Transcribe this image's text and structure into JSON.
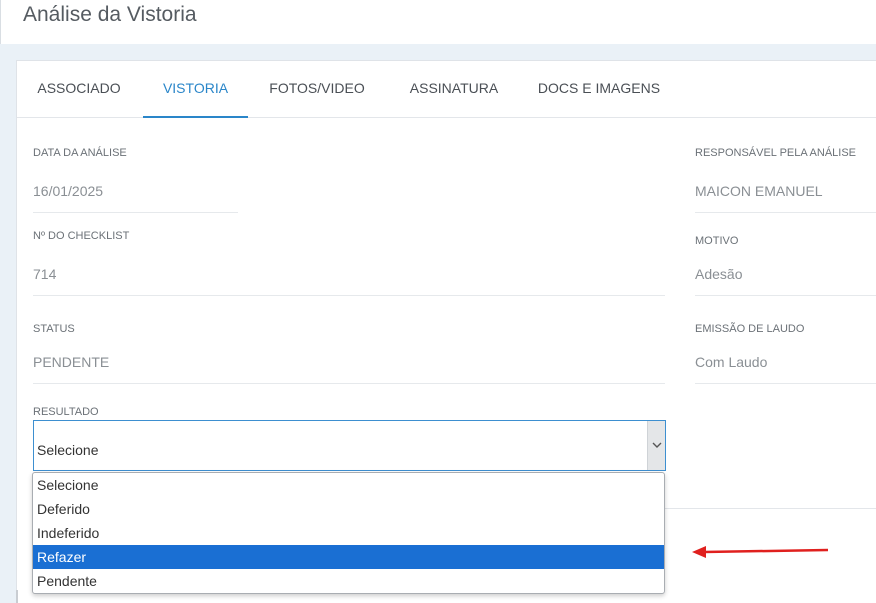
{
  "header": {
    "title": "Análise da Vistoria"
  },
  "tabs": [
    {
      "label": "ASSOCIADO"
    },
    {
      "label": "VISTORIA"
    },
    {
      "label": "FOTOS/VIDEO"
    },
    {
      "label": "ASSINATURA"
    },
    {
      "label": "DOCS E IMAGENS"
    }
  ],
  "active_tab": "VISTORIA",
  "fields": {
    "data_analise": {
      "label": "DATA DA ANÁLISE",
      "value": "16/01/2025"
    },
    "responsavel": {
      "label": "RESPONSÁVEL PELA ANÁLISE",
      "value": "MAICON EMANUEL"
    },
    "checklist": {
      "label": "Nº DO CHECKLIST",
      "value": "714"
    },
    "motivo": {
      "label": "MOTIVO",
      "value": "Adesão"
    },
    "status": {
      "label": "STATUS",
      "value": "PENDENTE"
    },
    "emissao": {
      "label": "EMISSÃO DE LAUDO",
      "value": "Com Laudo"
    }
  },
  "resultado": {
    "label": "RESULTADO",
    "selected": "Selecione",
    "options": [
      "Selecione",
      "Deferido",
      "Indeferido",
      "Refazer",
      "Pendente"
    ],
    "highlighted": "Refazer"
  },
  "colors": {
    "accent": "#2a86c9",
    "highlight": "#1a6fd3",
    "annotation_arrow": "#e0201e"
  }
}
